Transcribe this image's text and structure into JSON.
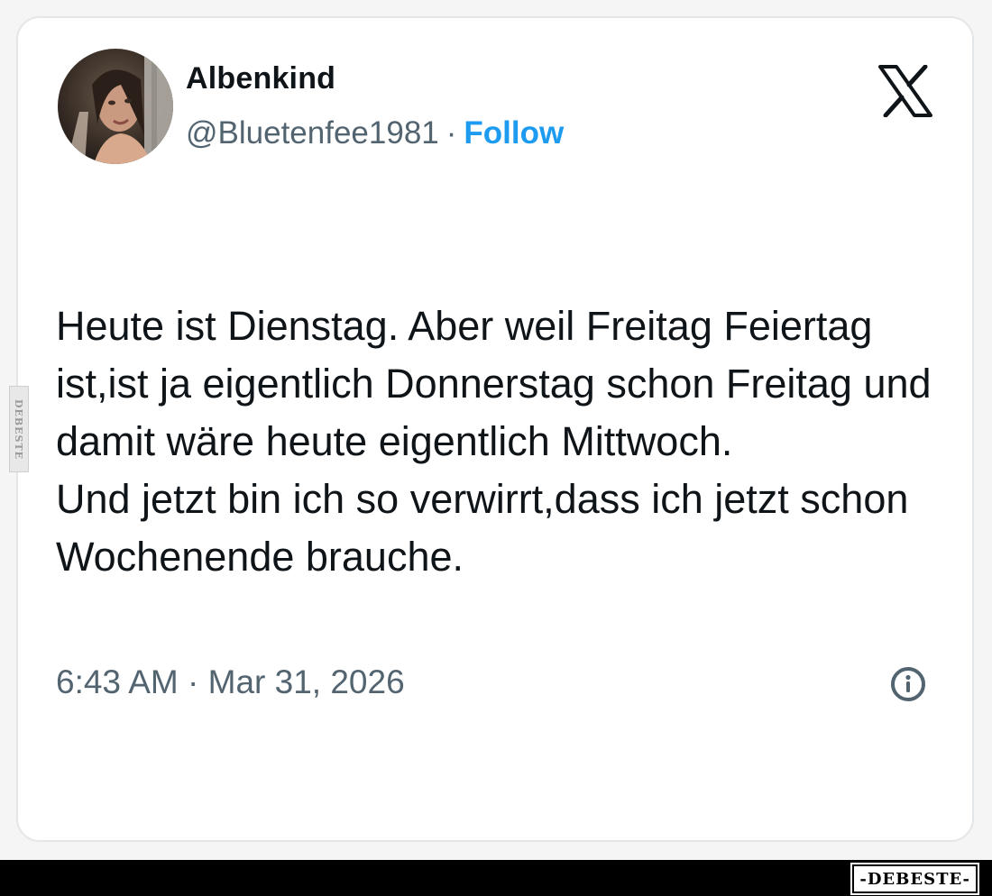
{
  "tweet": {
    "author_name": "Albenkind",
    "handle": "@Bluetenfee1981",
    "separator": "·",
    "follow_label": "Follow",
    "text_paragraphs": [
      "Heute ist Dienstag. Aber weil Freitag Feiertag ist,ist ja eigentlich Donnerstag schon Freitag und damit wäre heute eigentlich Mittwoch.",
      "Und jetzt bin ich so verwirrt,dass ich jetzt schon Wochenende brauche."
    ],
    "timestamp": "6:43 AM · Mar 31, 2026"
  },
  "icons": {
    "platform_logo": "x-logo-icon",
    "info": "info-icon"
  },
  "watermark": {
    "side_text": "DEBESTE",
    "bottom_text": "-DEBESTE-"
  },
  "colors": {
    "text_primary": "#0f1419",
    "text_secondary": "#536471",
    "accent": "#1d9bf0",
    "card_border": "#e3e6e8",
    "bottom_bar": "#000000"
  }
}
